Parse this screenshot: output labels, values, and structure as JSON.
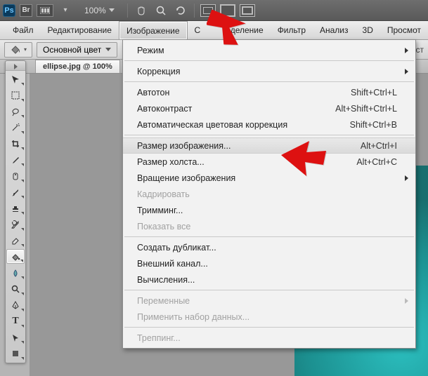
{
  "appbar": {
    "zoom": "100%"
  },
  "menubar": {
    "items": [
      "Файл",
      "Редактирование",
      "Изображение",
      "С",
      "деление",
      "Фильтр",
      "Анализ",
      "3D",
      "Просмот"
    ],
    "active_index": 2
  },
  "optbar": {
    "fill_label": "Основной цвет",
    "trail": "пуст"
  },
  "doc": {
    "tab_title": "ellipse.jpg @ 100%"
  },
  "menu": {
    "items": [
      {
        "label": "Режим",
        "submenu": true
      },
      {
        "sep": true
      },
      {
        "label": "Коррекция",
        "submenu": true
      },
      {
        "sep": true
      },
      {
        "label": "Автотон",
        "shortcut": "Shift+Ctrl+L"
      },
      {
        "label": "Автоконтраст",
        "shortcut": "Alt+Shift+Ctrl+L"
      },
      {
        "label": "Автоматическая цветовая коррекция",
        "shortcut": "Shift+Ctrl+B"
      },
      {
        "sep": true
      },
      {
        "label": "Размер изображения...",
        "shortcut": "Alt+Ctrl+I",
        "hover": true
      },
      {
        "label": "Размер холста...",
        "shortcut": "Alt+Ctrl+C"
      },
      {
        "label": "Вращение изображения",
        "submenu": true
      },
      {
        "label": "Кадрировать",
        "disabled": true
      },
      {
        "label": "Тримминг..."
      },
      {
        "label": "Показать все",
        "disabled": true
      },
      {
        "sep": true
      },
      {
        "label": "Создать дубликат..."
      },
      {
        "label": "Внешний канал..."
      },
      {
        "label": "Вычисления..."
      },
      {
        "sep": true
      },
      {
        "label": "Переменные",
        "submenu": true,
        "disabled": true
      },
      {
        "label": "Применить набор данных...",
        "disabled": true
      },
      {
        "sep": true
      },
      {
        "label": "Треппинг...",
        "disabled": true
      }
    ]
  }
}
